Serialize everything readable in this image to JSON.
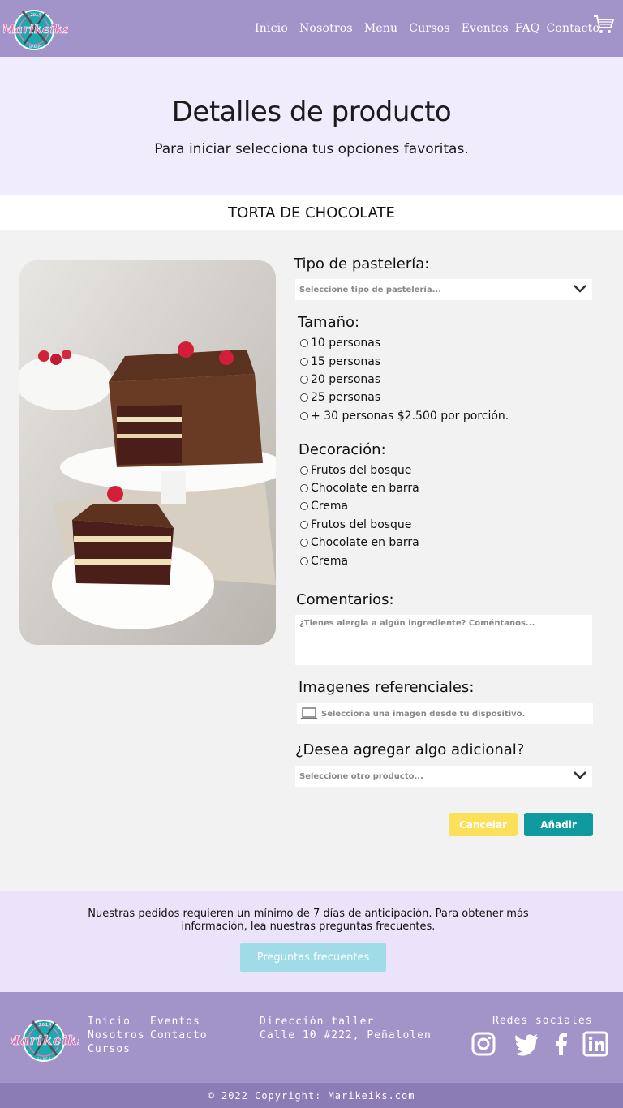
{
  "brand": {
    "logo_text": "Marikeiks",
    "logo_year": "2014",
    "logo_sub": "BAKERY"
  },
  "nav": {
    "items": [
      "Inicio",
      "Nosotros",
      "Menu",
      "Cursos",
      "Eventos",
      "FAQ",
      "Contacto"
    ],
    "cart_icon": "cart-icon"
  },
  "hero": {
    "title": "Detalles de producto",
    "subtitle": "Para iniciar selecciona tus opciones favoritas."
  },
  "product": {
    "name": "TORTA DE CHOCOLATE"
  },
  "form": {
    "tipo_label": "Tipo de pastelería:",
    "tipo_placeholder": "Seleccione tipo de pastelería...",
    "tamano_label": "Tamaño:",
    "tamano_options": [
      "10 personas",
      "15 personas",
      "20 personas",
      "25 personas",
      "+ 30 personas $2.500 por porción."
    ],
    "decoracion_label": "Decoración:",
    "decoracion_options": [
      "Frutos del bosque",
      "Chocolate en barra",
      "Crema",
      "Frutos del bosque",
      "Chocolate en barra",
      "Crema"
    ],
    "comentarios_label": "Comentarios:",
    "comentarios_placeholder": "¿Tienes alergia a algún ingrediente? Coméntanos...",
    "imagenes_label": "Imagenes referenciales:",
    "imagenes_placeholder": "Selecciona una imagen desde tu dispositivo.",
    "adicional_label": "¿Desea agregar algo adicional?",
    "adicional_placeholder": "Seleccione otro producto...",
    "cancel_label": "Cancelar",
    "add_label": "Añadir"
  },
  "notice": {
    "text": "Nuestras pedidos requieren un mínimo de 7 días de anticipación. Para obtener más información, lea nuestras preguntas frecuentes.",
    "button": "Preguntas frecuentes"
  },
  "footer": {
    "col1": [
      "Inicio",
      "Nosotros",
      "Cursos"
    ],
    "col2": [
      "Eventos",
      "Contacto"
    ],
    "address_title": "Dirección taller",
    "address": "Calle 10 #222, Peñalolen",
    "social_title": "Redes sociales",
    "social_icons": [
      "instagram-icon",
      "twitter-icon",
      "facebook-icon",
      "linkedin-icon"
    ],
    "copyright": "© 2022 Copyright: Marikeiks.com"
  },
  "colors": {
    "nav": "#a293c9",
    "hero": "#f1ecfc",
    "cancel": "#fde05a",
    "add": "#0e9a9e",
    "faq": "#9fdce8",
    "copyright_bar": "#8b7cb6"
  }
}
